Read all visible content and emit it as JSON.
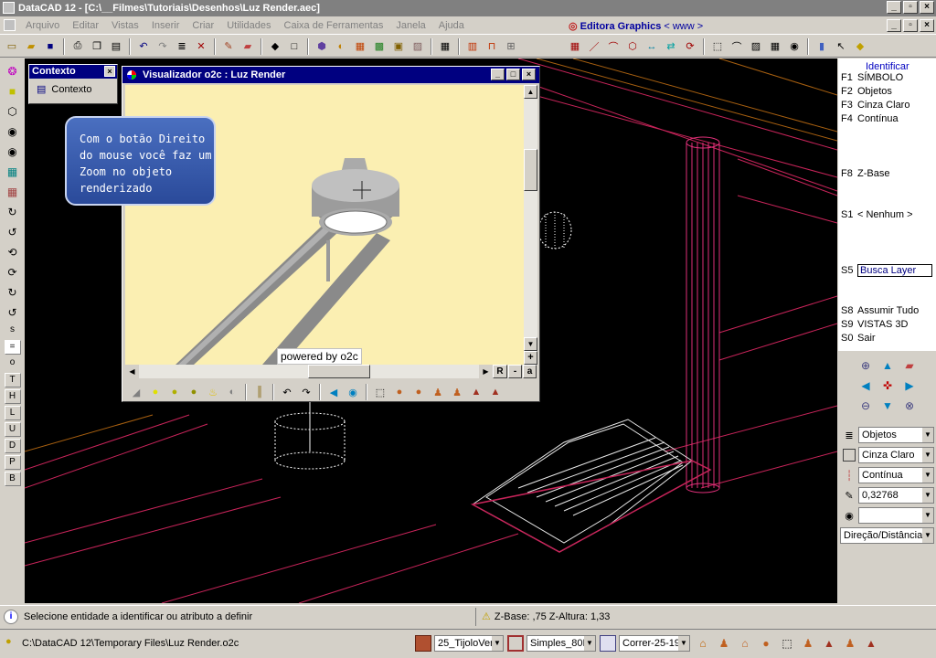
{
  "window": {
    "title": "DataCAD 12 - [C:\\__Filmes\\Tutoriais\\Desenhos\\Luz Render.aec]"
  },
  "menu": [
    "Arquivo",
    "Editar",
    "Vistas",
    "Inserir",
    "Criar",
    "Utilidades",
    "Caixa de Ferramentas",
    "Janela",
    "Ajuda"
  ],
  "brand": {
    "name": "Editora Graphics",
    "link": "< www >"
  },
  "left_toolbar_letters": [
    "s",
    "=",
    "o",
    "T",
    "H",
    "L",
    "U",
    "D",
    "P",
    "B"
  ],
  "context_panel": {
    "title": "Contexto",
    "item": "Contexto"
  },
  "viewer": {
    "title": "Visualizador o2c : Luz Render",
    "powered": "powered by o2c",
    "right_mini": [
      "R",
      "-",
      "a"
    ],
    "vscroll_plus": "+"
  },
  "tooltip": {
    "lines": [
      "Com o botão Direito",
      "do mouse você faz um",
      "Zoom no objeto",
      "renderizado"
    ]
  },
  "fkeys": {
    "title": "Identificar",
    "items": [
      {
        "key": "F1",
        "label": "SÍMBOLO"
      },
      {
        "key": "F2",
        "label": "Objetos"
      },
      {
        "key": "F3",
        "label": "Cinza Claro"
      },
      {
        "key": "F4",
        "label": "Contínua"
      },
      {
        "key": "F8",
        "label": "Z-Base"
      },
      {
        "key": "S1",
        "label": "< Nenhum >"
      },
      {
        "key": "S5",
        "label": "Busca Layer"
      },
      {
        "key": "S8",
        "label": "Assumir Tudo"
      },
      {
        "key": "S9",
        "label": "VISTAS 3D"
      },
      {
        "key": "S0",
        "label": "Sair"
      }
    ]
  },
  "dropdowns": {
    "layer": "Objetos",
    "color": "Cinza Claro",
    "linetype": "Contínua",
    "weight": "0,32768",
    "blank": "",
    "mode": "Direção/Distância"
  },
  "status": {
    "message": "Selecione entidade a identificar ou atributo a definir",
    "zbase": "Z-Base: ,75 Z-Altura: 1,33",
    "file": "C:\\DataCAD 12\\Temporary Files\\Luz Render.o2c",
    "hatch": "25_TijoloVer",
    "line1": "Simples_80B",
    "line2": "Correr-25-19"
  },
  "colors": {
    "titlebar": "#808080",
    "wire_red": "#c8245a",
    "wire_orange": "#a86010",
    "render_bg": "#fbefb2",
    "tooltip": "#2f54a8"
  }
}
